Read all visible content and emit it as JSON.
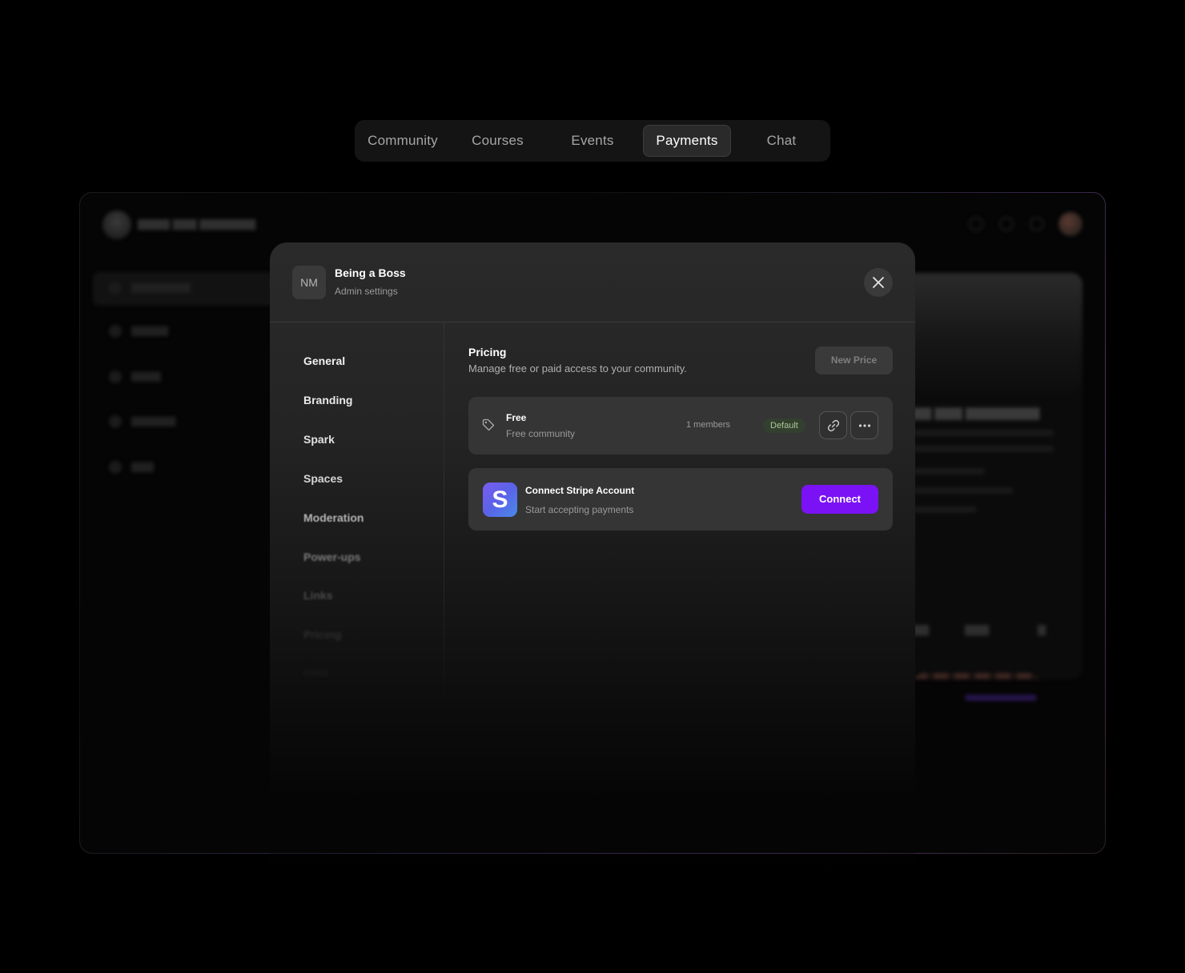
{
  "tabs": [
    {
      "label": "Community",
      "active": false
    },
    {
      "label": "Courses",
      "active": false
    },
    {
      "label": "Events",
      "active": false
    },
    {
      "label": "Payments",
      "active": true
    },
    {
      "label": "Chat",
      "active": false
    }
  ],
  "modal": {
    "avatar_initials": "NM",
    "title": "Being a Boss",
    "subtitle": "Admin settings",
    "nav": [
      {
        "label": "General"
      },
      {
        "label": "Branding"
      },
      {
        "label": "Spark"
      },
      {
        "label": "Spaces"
      },
      {
        "label": "Moderation"
      },
      {
        "label": "Power-ups"
      },
      {
        "label": "Links"
      },
      {
        "label": "Pricing"
      },
      {
        "label": "Invite"
      }
    ],
    "section": {
      "title": "Pricing",
      "description": "Manage free or paid access to your community.",
      "new_price_label": "New Price"
    },
    "price": {
      "name": "Free",
      "description": "Free community",
      "members": "1 members",
      "badge": "Default",
      "icons": [
        "tag-icon",
        "link-icon",
        "more-icon"
      ]
    },
    "stripe": {
      "logo_letter": "S",
      "title": "Connect Stripe Account",
      "description": "Start accepting payments",
      "button_label": "Connect"
    }
  },
  "colors": {
    "accent": "#7a12f5",
    "badge_bg": "#34402f",
    "badge_text": "#a9c79a"
  }
}
